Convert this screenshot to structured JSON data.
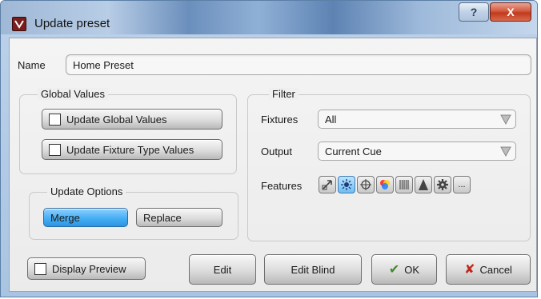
{
  "window": {
    "title": "Update preset",
    "help_label": "?",
    "close_label": "X"
  },
  "name": {
    "label": "Name",
    "value": "Home Preset"
  },
  "global_values": {
    "legend": "Global Values",
    "update_global": "Update Global Values",
    "update_fixture_type": "Update Fixture Type Values"
  },
  "update_options": {
    "legend": "Update Options",
    "merge": "Merge",
    "replace": "Replace",
    "selected": "Merge"
  },
  "filter": {
    "legend": "Filter",
    "fixtures_label": "Fixtures",
    "fixtures_value": "All",
    "output_label": "Output",
    "output_value": "Current Cue",
    "features_label": "Features",
    "features": [
      {
        "icon": "position-icon",
        "active": false
      },
      {
        "icon": "intensity-icon",
        "active": true
      },
      {
        "icon": "focus-crosshair-icon",
        "active": false
      },
      {
        "icon": "color-wheel-icon",
        "active": false
      },
      {
        "icon": "gobo-beam-icon",
        "active": false
      },
      {
        "icon": "beam-shape-icon",
        "active": false
      },
      {
        "icon": "gear-icon",
        "active": false
      },
      {
        "icon": "more-icon",
        "active": false,
        "label": "..."
      }
    ]
  },
  "footer": {
    "display_preview": "Display Preview",
    "edit": "Edit",
    "edit_blind": "Edit Blind",
    "ok": "OK",
    "cancel": "Cancel"
  }
}
